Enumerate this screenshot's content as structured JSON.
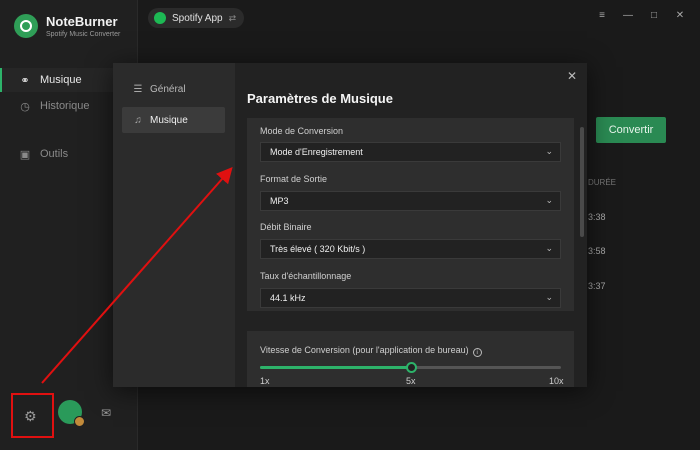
{
  "app": {
    "name": "NoteBurner",
    "subtitle": "Spotify Music Converter",
    "source_label": "Spotify App",
    "accent": "#2db36a"
  },
  "sidebar": {
    "items": [
      {
        "label": "Musique",
        "icon": "headphones-icon",
        "active": true
      },
      {
        "label": "Historique",
        "icon": "clock-icon",
        "active": false
      },
      {
        "label": "Outils",
        "icon": "toolbox-icon",
        "active": false
      }
    ]
  },
  "background": {
    "convert_label": "Convertir",
    "duration_header": "DURÉE",
    "durations": [
      "3:38",
      "3:58",
      "3:37"
    ]
  },
  "settings": {
    "title": "Paramètres de Musique",
    "nav": {
      "general": "Général",
      "music": "Musique"
    },
    "fields": [
      {
        "label": "Mode de Conversion",
        "value": "Mode d'Enregistrement"
      },
      {
        "label": "Format de Sortie",
        "value": "MP3"
      },
      {
        "label": "Débit Binaire",
        "value": "Très élevé ( 320 Kbit/s )"
      },
      {
        "label": "Taux d'échantillonnage",
        "value": "44.1 kHz"
      }
    ],
    "speed": {
      "label": "Vitesse de Conversion (pour l'application de bureau)",
      "min_label": "1x",
      "mid_label": "5x",
      "max_label": "10x",
      "value": 5,
      "min": 1,
      "max": 10
    }
  },
  "annotation": {
    "color": "#e01010"
  }
}
